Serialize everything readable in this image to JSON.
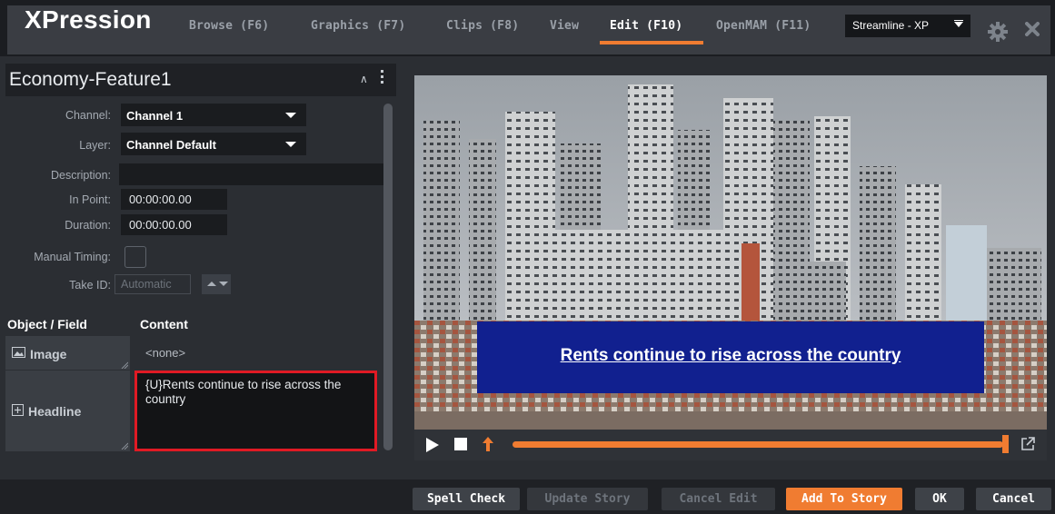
{
  "app": {
    "logo": "XPression",
    "tabs": [
      {
        "label": "Browse (F6)"
      },
      {
        "label": "Graphics (F7)"
      },
      {
        "label": "Clips (F8)"
      },
      {
        "label": "View"
      },
      {
        "label": "Edit (F10)"
      },
      {
        "label": "OpenMAM (F11)"
      }
    ],
    "active_tab": "Edit (F10)",
    "profile_select": "Streamline - XP",
    "accent_color": "#f07c31"
  },
  "editor": {
    "title": "Economy-Feature1",
    "channel_label": "Channel:",
    "channel_value": "Channel 1",
    "layer_label": "Layer:",
    "layer_value": "Channel Default",
    "description_label": "Description:",
    "description_value": "",
    "in_point_label": "In Point:",
    "in_point_value": "00:00:00.00",
    "duration_label": "Duration:",
    "duration_value": "00:00:00.00",
    "manual_timing_label": "Manual Timing:",
    "take_id_label": "Take ID:",
    "take_id_placeholder": "Automatic"
  },
  "fields_table": {
    "col_object": "Object / Field",
    "col_content": "Content",
    "rows": [
      {
        "name": "Image",
        "content": "<none>"
      },
      {
        "name": "Headline",
        "content": "{U}Rents continue to rise across the country"
      }
    ]
  },
  "preview": {
    "headline_text": "Rents continue to rise across the country",
    "progress_fraction": 1.0
  },
  "bottom_buttons": {
    "spell_check": "Spell Check",
    "update_story": "Update Story",
    "cancel_edit": "Cancel Edit",
    "add_to_story": "Add To Story",
    "ok": "OK",
    "cancel": "Cancel"
  }
}
